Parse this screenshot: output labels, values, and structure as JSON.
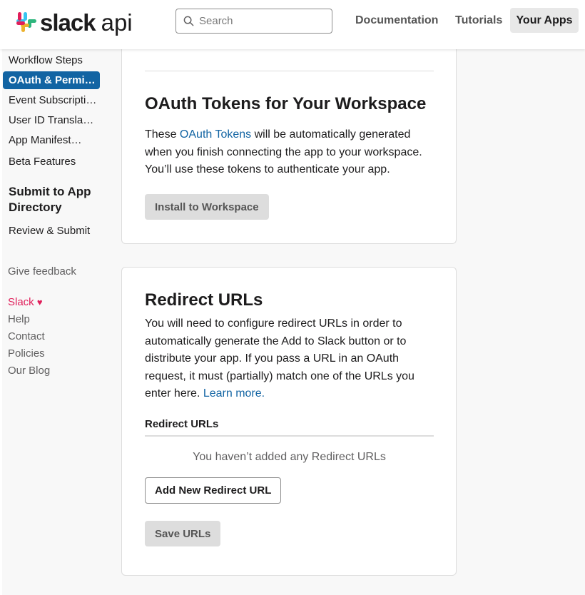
{
  "header": {
    "logo_word": "slack",
    "logo_suffix": "api",
    "search_placeholder": "Search",
    "nav": [
      "Documentation",
      "Tutorials",
      "Your Apps"
    ]
  },
  "sidebar": {
    "items": [
      "Workflow Steps",
      "OAuth & Permi…",
      "Event Subscripti…",
      "User ID Transla…",
      "App Manifest…",
      "Beta Features"
    ],
    "active_index": 1,
    "section_heading": "Submit to App Directory",
    "section_items": [
      "Review & Submit"
    ],
    "feedback": "Give feedback",
    "footer_links": [
      "Slack",
      "Help",
      "Contact",
      "Policies",
      "Our Blog"
    ]
  },
  "oauth_tokens": {
    "title": "OAuth Tokens for Your Workspace",
    "text_before": "These ",
    "link": "OAuth Tokens",
    "text_after": " will be automatically generated when you finish connecting the app to your workspace. You’ll use these tokens to authenticate your app.",
    "install_button": "Install to Workspace"
  },
  "redirect": {
    "title": "Redirect URLs",
    "text": "You will need to configure redirect URLs in order to automatically generate the Add to Slack button or to distribute your app. If you pass a URL in an OAuth request, it must (partially) match one of the URLs you enter here. ",
    "link": "Learn more.",
    "list_heading": "Redirect URLs",
    "empty_message": "You haven’t added any Redirect URLs",
    "add_button": "Add New Redirect URL",
    "save_button": "Save URLs"
  },
  "colors": {
    "link": "#1264a3",
    "active_nav": "#1264a3",
    "brand_pink": "#e01e5a"
  }
}
